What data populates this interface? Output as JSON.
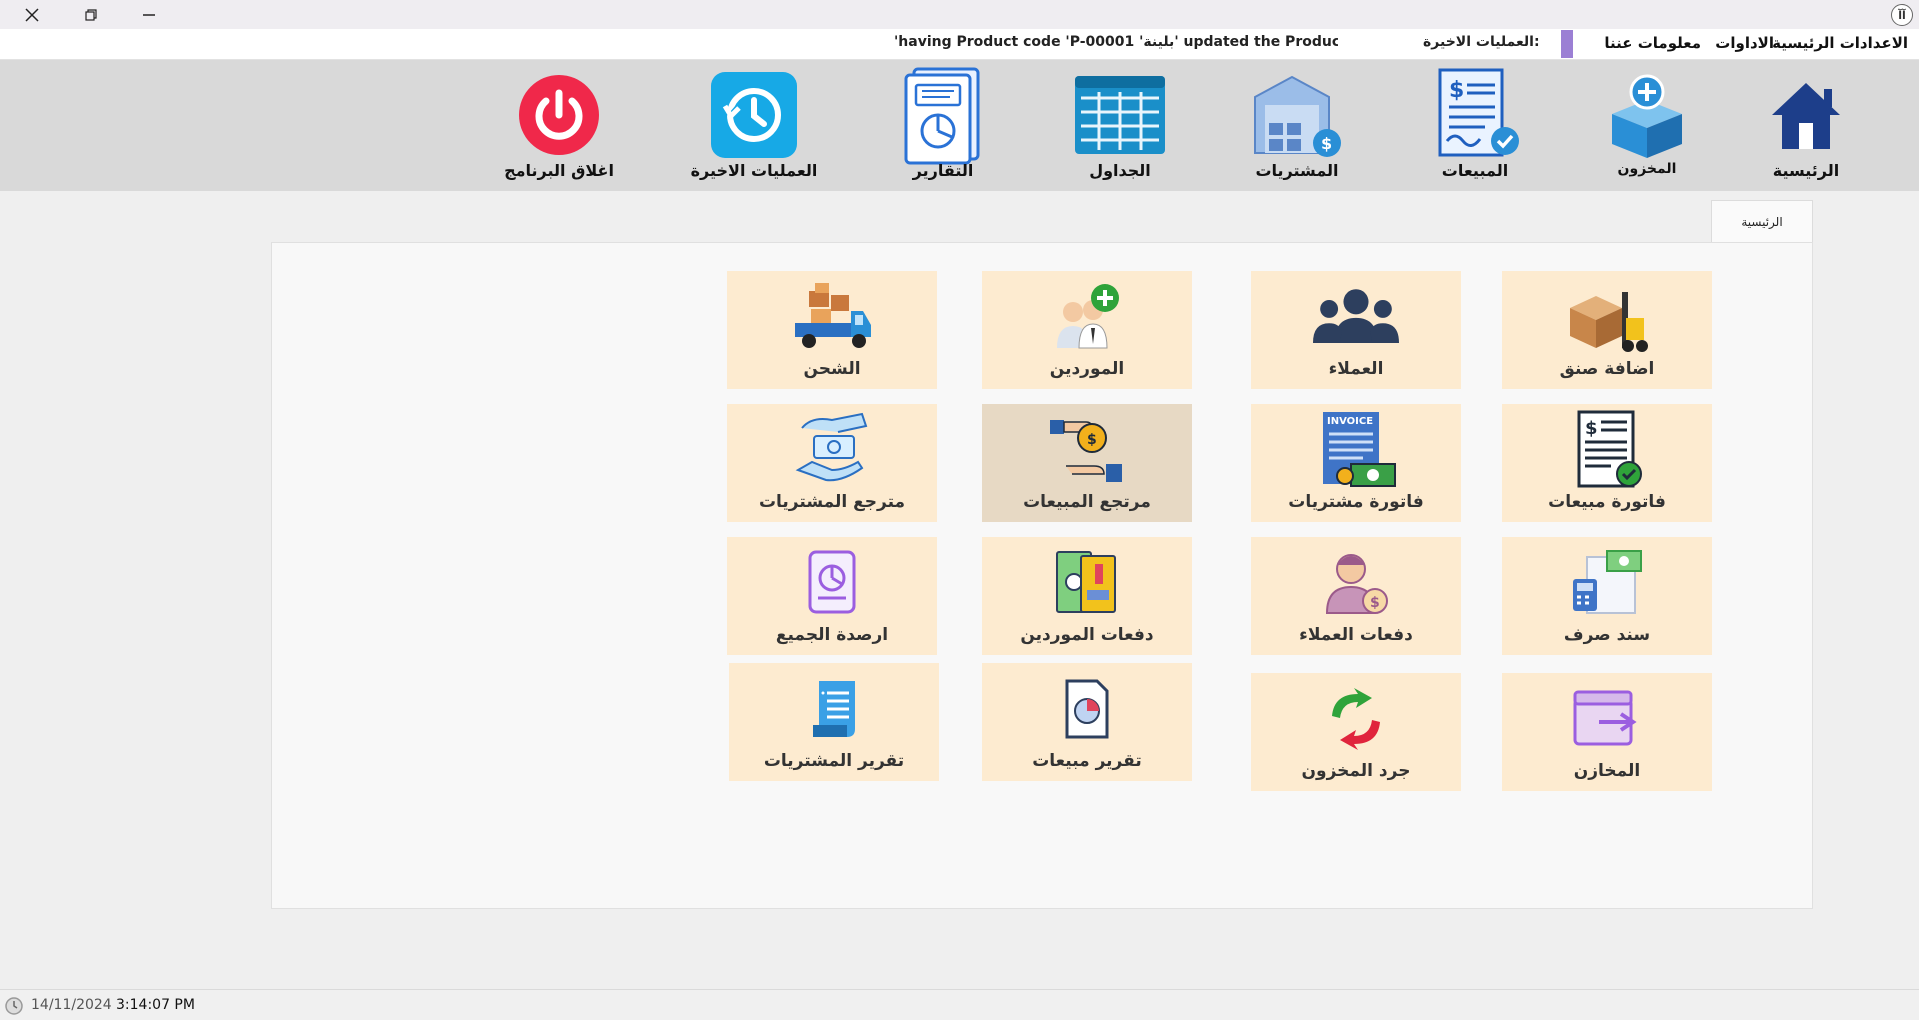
{
  "window": {
    "app_icon_text": "آآ"
  },
  "menu": {
    "items": [
      "الاعدادات الرئيسية",
      "الاداوات",
      "معلومات عننا"
    ],
    "recent_label": "العمليات الاخيرة:",
    "recent_text": "'having Product code 'P-00001 'بلينة' updated the Product"
  },
  "toolbar": [
    {
      "label": "الرئيسية",
      "icon": "home-icon"
    },
    {
      "label": "المخزون",
      "icon": "inventory-box-icon"
    },
    {
      "label": "المبيعات",
      "icon": "sales-invoice-icon"
    },
    {
      "label": "المشتريات",
      "icon": "warehouse-purchases-icon"
    },
    {
      "label": "الجداول",
      "icon": "table-icon"
    },
    {
      "label": "التقارير",
      "icon": "report-icon"
    },
    {
      "label": "العمليات الاخيرة",
      "icon": "history-icon"
    },
    {
      "label": "اغلاق البرنامج",
      "icon": "power-icon"
    }
  ],
  "tab": {
    "label": "الرئيسية"
  },
  "tiles": [
    {
      "label": "اضافة صنق",
      "icon": "forklift-boxes-icon"
    },
    {
      "label": "العملاء",
      "icon": "customers-group-icon"
    },
    {
      "label": "الموردين",
      "icon": "add-supplier-icon"
    },
    {
      "label": "الشحن",
      "icon": "shipping-truck-icon"
    },
    {
      "label": "فاتورة مبيعات",
      "icon": "sales-invoice-icon"
    },
    {
      "label": "فاتورة مشتريات",
      "icon": "purchase-invoice-icon"
    },
    {
      "label": "مرتجع المبيعات",
      "icon": "sales-return-icon"
    },
    {
      "label": "مترجع المشتريات",
      "icon": "purchase-return-icon"
    },
    {
      "label": "سند صرف",
      "icon": "payment-voucher-icon"
    },
    {
      "label": "دفعات العملاء",
      "icon": "customer-payments-icon"
    },
    {
      "label": "دفعات الموردين",
      "icon": "supplier-payments-icon"
    },
    {
      "label": "ارصدة الجميع",
      "icon": "balances-icon"
    },
    {
      "label": "المخازن",
      "icon": "stores-box-icon"
    },
    {
      "label": "جرد المخزون",
      "icon": "stocktaking-icon"
    },
    {
      "label": "تقرير مبيعات",
      "icon": "sales-report-icon"
    },
    {
      "label": "تقرير المشتريات",
      "icon": "purchases-report-icon"
    }
  ],
  "status": {
    "date": "14/11/2024",
    "time": "3:14:07 PM"
  }
}
